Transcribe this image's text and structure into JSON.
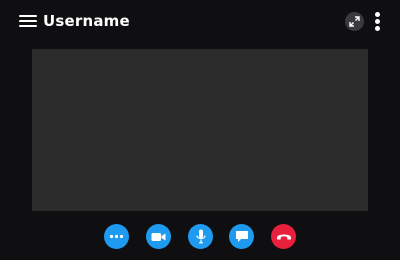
{
  "header": {
    "title": "Username",
    "menu_icon": "hamburger-menu-icon",
    "expand_icon": "expand-arrows-icon",
    "more_icon": "vertical-ellipsis-icon"
  },
  "video": {
    "background": "#2c2c2d"
  },
  "controls": [
    {
      "name": "more-options",
      "icon": "horizontal-ellipsis-icon",
      "color": "#1e9bf0"
    },
    {
      "name": "video-camera",
      "icon": "video-camera-icon",
      "color": "#1e9bf0"
    },
    {
      "name": "microphone",
      "icon": "microphone-icon",
      "color": "#1e9bf0"
    },
    {
      "name": "chat",
      "icon": "chat-bubble-icon",
      "color": "#1e9bf0"
    },
    {
      "name": "end-call",
      "icon": "hang-up-phone-icon",
      "color": "#e8203b"
    }
  ],
  "colors": {
    "background": "#0f0f12",
    "accent": "#1e9bf0",
    "danger": "#e8203b",
    "text": "#ffffff"
  }
}
